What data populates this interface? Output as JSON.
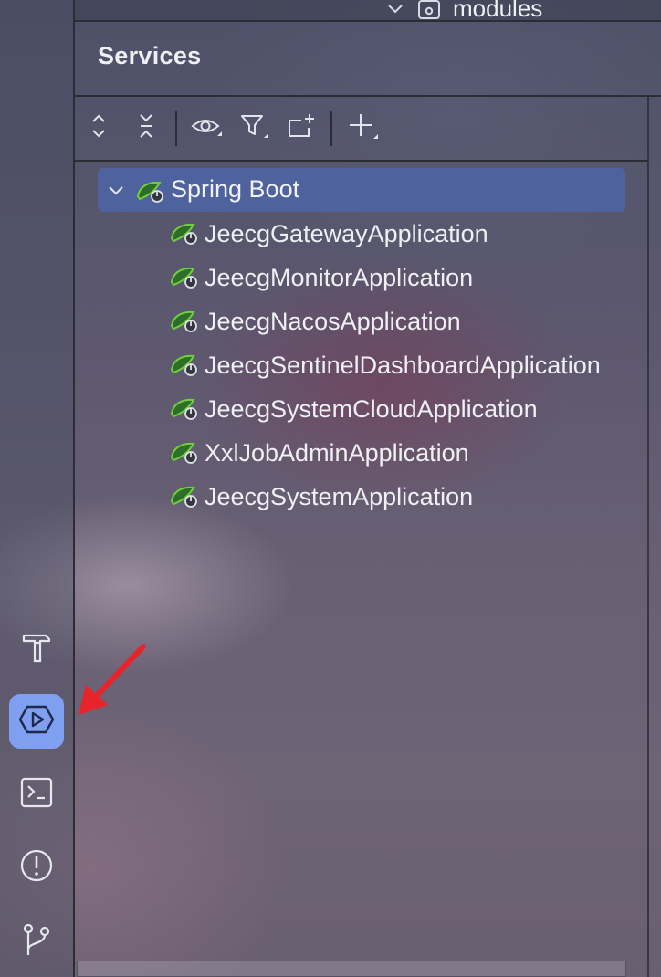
{
  "top_bar": {
    "modules_label": "modules",
    "chevron_icon": "chevron-down-icon",
    "folder_icon": "folder-icon"
  },
  "services_panel": {
    "title": "Services",
    "toolbar_icons": [
      "expand-all-icon",
      "collapse-all-icon",
      "eye-icon",
      "filter-icon",
      "new-tab-icon",
      "add-icon"
    ],
    "tree": {
      "root": {
        "label": "Spring Boot",
        "icon": "spring-boot-icon",
        "expanded": true,
        "selected": true
      },
      "children": [
        {
          "label": "JeecgGatewayApplication"
        },
        {
          "label": "JeecgMonitorApplication"
        },
        {
          "label": "JeecgNacosApplication"
        },
        {
          "label": "JeecgSentinelDashboardApplication"
        },
        {
          "label": "JeecgSystemCloudApplication"
        },
        {
          "label": "XxlJobAdminApplication"
        },
        {
          "label": "JeecgSystemApplication"
        }
      ]
    }
  },
  "sidebar": {
    "items": [
      {
        "icon": "hammer-icon",
        "active": false
      },
      {
        "icon": "services-icon",
        "active": true
      },
      {
        "icon": "terminal-icon",
        "active": false
      },
      {
        "icon": "problems-icon",
        "active": false
      },
      {
        "icon": "git-icon",
        "active": false
      }
    ]
  },
  "colors": {
    "selection": "#4c66ac",
    "active_tool": "#7f9ff0",
    "annotation_arrow": "#e8232a",
    "spring_green": "#5fb832"
  }
}
